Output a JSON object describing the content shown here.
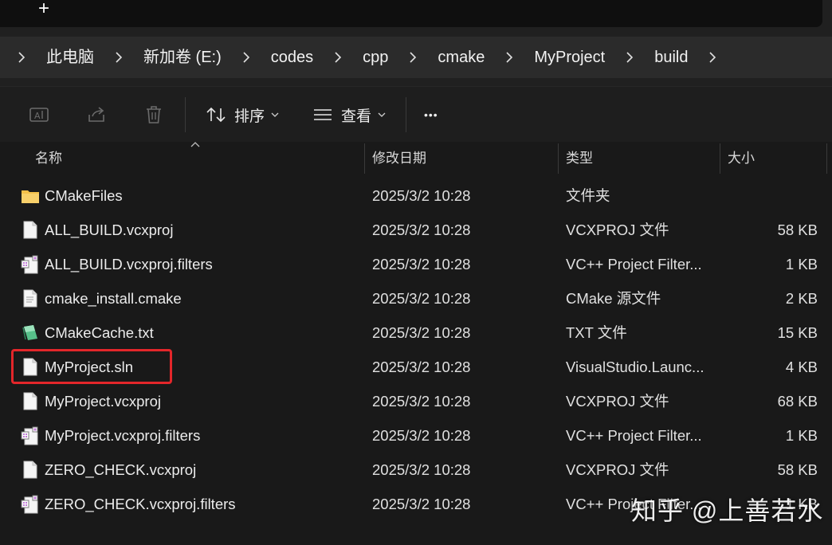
{
  "tabstrip": {
    "new_tab_glyph": "+"
  },
  "breadcrumb": {
    "items": [
      "此电脑",
      "新加卷 (E:)",
      "codes",
      "cpp",
      "cmake",
      "MyProject",
      "build"
    ]
  },
  "toolbar": {
    "sort_label": "排序",
    "view_label": "查看",
    "more_glyph": "•••"
  },
  "columns": {
    "name": "名称",
    "date": "修改日期",
    "type": "类型",
    "size": "大小"
  },
  "files": [
    {
      "icon": "folder-icon",
      "name": "CMakeFiles",
      "date": "2025/3/2 10:28",
      "type": "文件夹",
      "size": ""
    },
    {
      "icon": "file-icon",
      "name": "ALL_BUILD.vcxproj",
      "date": "2025/3/2 10:28",
      "type": "VCXPROJ 文件",
      "size": "58 KB"
    },
    {
      "icon": "filters-file-icon",
      "name": "ALL_BUILD.vcxproj.filters",
      "date": "2025/3/2 10:28",
      "type": "VC++ Project Filter...",
      "size": "1 KB"
    },
    {
      "icon": "text-file-icon",
      "name": "cmake_install.cmake",
      "date": "2025/3/2 10:28",
      "type": "CMake 源文件",
      "size": "2 KB"
    },
    {
      "icon": "notepad-file-icon",
      "name": "CMakeCache.txt",
      "date": "2025/3/2 10:28",
      "type": "TXT 文件",
      "size": "15 KB"
    },
    {
      "icon": "file-icon",
      "name": "MyProject.sln",
      "date": "2025/3/2 10:28",
      "type": "VisualStudio.Launc...",
      "size": "4 KB"
    },
    {
      "icon": "file-icon",
      "name": "MyProject.vcxproj",
      "date": "2025/3/2 10:28",
      "type": "VCXPROJ 文件",
      "size": "68 KB"
    },
    {
      "icon": "filters-file-icon",
      "name": "MyProject.vcxproj.filters",
      "date": "2025/3/2 10:28",
      "type": "VC++ Project Filter...",
      "size": "1 KB"
    },
    {
      "icon": "file-icon",
      "name": "ZERO_CHECK.vcxproj",
      "date": "2025/3/2 10:28",
      "type": "VCXPROJ 文件",
      "size": "58 KB"
    },
    {
      "icon": "filters-file-icon",
      "name": "ZERO_CHECK.vcxproj.filters",
      "date": "2025/3/2 10:28",
      "type": "VC++ Project Filter...",
      "size": "1 KB"
    }
  ],
  "watermark": "知乎 @上善若水",
  "colors": {
    "highlight": "#e3262a",
    "folder": "#f3c04a",
    "accent_icon": "#c07ad6"
  }
}
